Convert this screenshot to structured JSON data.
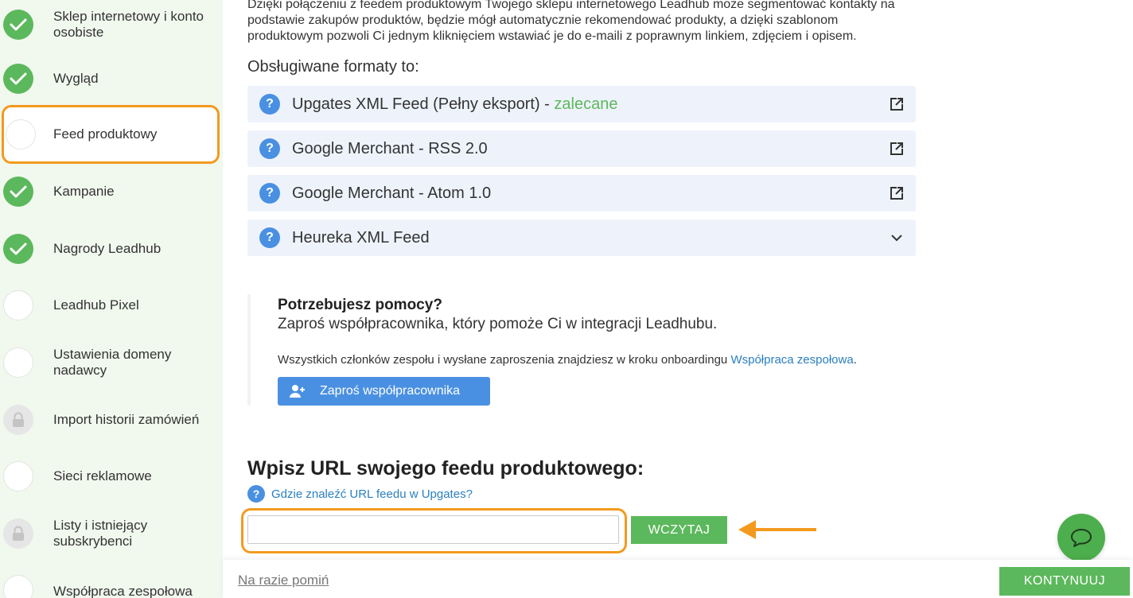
{
  "sidebar": {
    "steps": [
      {
        "label": "Sklep internetowy i konto osobiste",
        "status": "done"
      },
      {
        "label": "Wygląd",
        "status": "done"
      },
      {
        "label": "Feed produktowy",
        "status": "active"
      },
      {
        "label": "Kampanie",
        "status": "done"
      },
      {
        "label": "Nagrody Leadhub",
        "status": "done"
      },
      {
        "label": "Leadhub Pixel",
        "status": "todo"
      },
      {
        "label": "Ustawienia domeny nadawcy",
        "status": "todo"
      },
      {
        "label": "Import historii zamówień",
        "status": "locked"
      },
      {
        "label": "Sieci reklamowe",
        "status": "todo"
      },
      {
        "label": "Listy i istniejący subskrybenci",
        "status": "locked"
      },
      {
        "label": "Współpraca zespołowa",
        "status": "todo"
      }
    ]
  },
  "main": {
    "intro": "Dzięki połączeniu z feedem produktowym Twojego sklepu internetowego Leadhub może segmentować kontakty na podstawie zakupów produktów, będzie mógł automatycznie rekomendować produkty, a dzięki szablonom produktowym pozwoli Ci jednym kliknięciem wstawiać je do e-maili z poprawnym linkiem, zdjęciem i opisem.",
    "formats_title": "Obsługiwane formaty to:",
    "formats": [
      {
        "label": "Upgates XML Feed (Pełny eksport) - ",
        "recommended": "zalecane",
        "action": "external-link-icon"
      },
      {
        "label": "Google Merchant - RSS 2.0",
        "recommended": "",
        "action": "external-link-icon"
      },
      {
        "label": "Google Merchant - Atom 1.0",
        "recommended": "",
        "action": "external-link-icon"
      },
      {
        "label": "Heureka XML Feed",
        "recommended": "",
        "action": "chevron-down-icon"
      }
    ],
    "help": {
      "title": "Potrzebujesz pomocy?",
      "subtitle": "Zaproś współpracownika, który pomoże Ci w integracji Leadhubu.",
      "text": "Wszystkich członków zespołu i wysłane zaproszenia znajdziesz w kroku onboardingu ",
      "link": "Współpraca zespołowa",
      "text_end": ".",
      "button": "Zaproś współpracownika"
    },
    "url_section": {
      "title": "Wpisz URL swojego feedu produktowego:",
      "help_link": "Gdzie znaleźć URL feedu w Upgates?",
      "input_value": "",
      "load_button": "WCZYTAJ"
    }
  },
  "footer": {
    "skip": "Na razie pomiń",
    "continue": "KONTYNUUJ"
  },
  "colors": {
    "accent_green": "#5cb85c",
    "accent_blue": "#4a90e2",
    "highlight_orange": "#f39a1e",
    "sidebar_bg": "#f1f8ee"
  }
}
